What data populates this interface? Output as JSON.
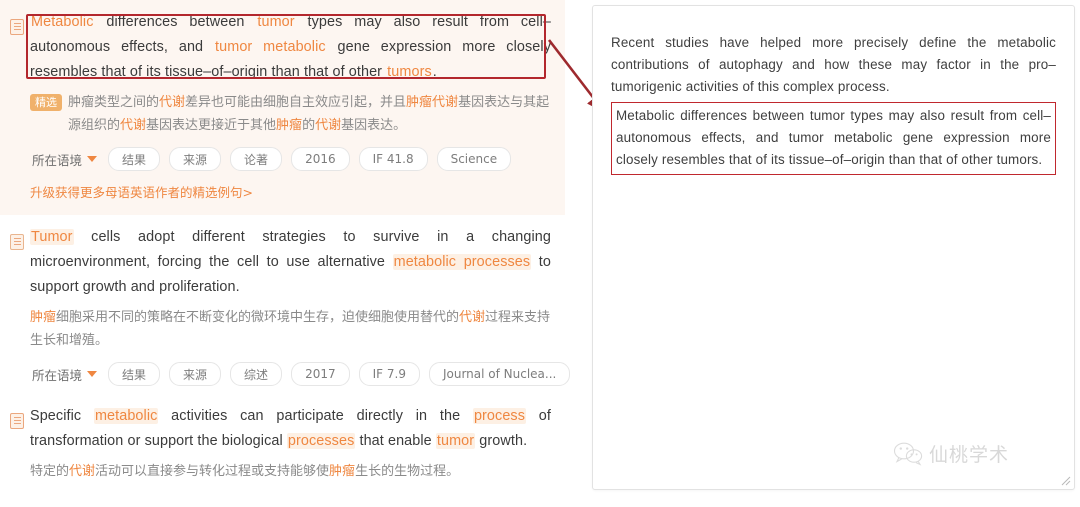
{
  "colors": {
    "accent_orange": "#ef8741",
    "annotation_red": "#b3272d",
    "featured_bg": "#fdf6f1",
    "badge_orange": "#f0b16b",
    "body_text": "#3b3b3b",
    "zh_text": "#8a8a8a"
  },
  "left_pane": {
    "results": [
      {
        "featured": true,
        "doc_icon": "document-icon",
        "en_parts": [
          {
            "t": "Metabolic",
            "kw": true
          },
          {
            "t": " differences between ",
            "kw": false
          },
          {
            "t": "tumor",
            "kw": true
          },
          {
            "t": " types may also result from cell–autonomous effects, and ",
            "kw": false
          },
          {
            "t": "tumor metabolic",
            "kw": true
          },
          {
            "t": " gene expression more closely resembles that of its tissue–of–origin than that of other ",
            "kw": false
          },
          {
            "t": "tumors",
            "kw": true
          },
          {
            "t": ".",
            "kw": false
          }
        ],
        "badge": "精选",
        "zh_parts": [
          {
            "t": "肿瘤类型之间的",
            "kw": false
          },
          {
            "t": "代谢",
            "kw": true
          },
          {
            "t": "差异也可能由细胞自主效应引起，并且",
            "kw": false
          },
          {
            "t": "肿瘤代谢",
            "kw": true
          },
          {
            "t": "基因表达与其起源组织的",
            "kw": false
          },
          {
            "t": "代谢",
            "kw": true
          },
          {
            "t": "基因表达更接近于其他",
            "kw": false
          },
          {
            "t": "肿瘤",
            "kw": true
          },
          {
            "t": "的",
            "kw": false
          },
          {
            "t": "代谢",
            "kw": true
          },
          {
            "t": "基因表达。",
            "kw": false
          }
        ],
        "tags": [
          {
            "label": "所在语境",
            "type": "dropdown"
          },
          {
            "label": "结果",
            "type": "pill"
          },
          {
            "label": "来源",
            "type": "pill"
          },
          {
            "label": "论著",
            "type": "pill"
          },
          {
            "label": "2016",
            "type": "pill"
          },
          {
            "label": "IF 41.8",
            "type": "pill"
          },
          {
            "label": "Science",
            "type": "pill"
          }
        ],
        "upgrade_link": "升级获得更多母语英语作者的精选例句>"
      },
      {
        "featured": false,
        "doc_icon": "documents-stack-icon",
        "en_parts": [
          {
            "t": "Tumor",
            "kw": true
          },
          {
            "t": " cells adopt different strategies to survive in a changing microenvironment, forcing the cell to use alternative ",
            "kw": false
          },
          {
            "t": "metabolic processes",
            "kw": true
          },
          {
            "t": " to support growth and proliferation.",
            "kw": false
          }
        ],
        "badge": "",
        "zh_parts": [
          {
            "t": "肿瘤",
            "kw": true
          },
          {
            "t": "细胞采用不同的策略在不断变化的微环境中生存，迫使细胞使用替代的",
            "kw": false
          },
          {
            "t": "代谢",
            "kw": true
          },
          {
            "t": "过程来支持生长和增殖。",
            "kw": false
          }
        ],
        "tags": [
          {
            "label": "所在语境",
            "type": "dropdown"
          },
          {
            "label": "结果",
            "type": "pill"
          },
          {
            "label": "来源",
            "type": "pill"
          },
          {
            "label": "综述",
            "type": "pill"
          },
          {
            "label": "2017",
            "type": "pill"
          },
          {
            "label": "IF 7.9",
            "type": "pill"
          },
          {
            "label": "Journal of Nuclea...",
            "type": "pill"
          }
        ],
        "upgrade_link": ""
      },
      {
        "featured": false,
        "doc_icon": "document-icon",
        "en_parts": [
          {
            "t": "Specific ",
            "kw": false
          },
          {
            "t": "metabolic",
            "kw": true
          },
          {
            "t": " activities can participate directly in the ",
            "kw": false
          },
          {
            "t": "process",
            "kw": true
          },
          {
            "t": " of transformation or support the biological ",
            "kw": false
          },
          {
            "t": "processes",
            "kw": true
          },
          {
            "t": " that enable ",
            "kw": false
          },
          {
            "t": "tumor",
            "kw": true
          },
          {
            "t": " growth.",
            "kw": false
          }
        ],
        "badge": "",
        "zh_parts": [
          {
            "t": "特定的",
            "kw": false
          },
          {
            "t": "代谢",
            "kw": true
          },
          {
            "t": "活动可以直接参与转化过程或支持能够使",
            "kw": false
          },
          {
            "t": "肿瘤",
            "kw": true
          },
          {
            "t": "生长的生物过程。",
            "kw": false
          }
        ],
        "tags": [],
        "upgrade_link": ""
      }
    ]
  },
  "right_pane": {
    "paragraphs": [
      {
        "highlighted": false,
        "text": "Recent studies have helped more precisely define the metabolic contributions of autophagy and how these may factor in the pro–tumorigenic activities of this complex process."
      },
      {
        "highlighted": true,
        "text": "Metabolic differences between tumor types may also result from cell–autonomous effects, and tumor metabolic gene expression more closely resembles that of its tissue–of–origin than that of other tumors."
      }
    ]
  },
  "watermark": {
    "icon": "wechat-logo-icon",
    "text": "仙桃学术"
  }
}
